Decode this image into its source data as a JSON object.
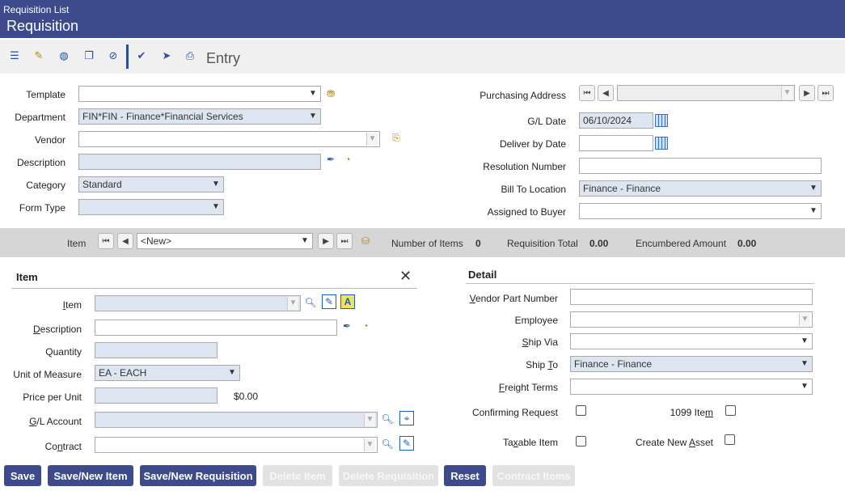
{
  "header": {
    "breadcrumb": "Requisition List",
    "title": "Requisition"
  },
  "toolbar": {
    "mode_label": "Entry",
    "icons": [
      "list-icon",
      "edit-icon",
      "globe-icon",
      "copy-icon",
      "void-icon",
      "approve-icon",
      "submit-icon",
      "print-icon"
    ]
  },
  "left_form": {
    "template": {
      "label": "Template",
      "value": ""
    },
    "department": {
      "label": "Department",
      "value": "FIN*FIN - Finance*Financial Services"
    },
    "vendor": {
      "label": "Vendor",
      "value": ""
    },
    "description": {
      "label": "Description",
      "value": ""
    },
    "category": {
      "label": "Category",
      "value": "Standard"
    },
    "form_type": {
      "label": "Form Type",
      "value": ""
    }
  },
  "right_form": {
    "purchasing_address": {
      "label": "Purchasing Address",
      "value": ""
    },
    "gl_date": {
      "label": "G/L Date",
      "value": "06/10/2024"
    },
    "deliver_by_date": {
      "label": "Deliver by Date",
      "value": ""
    },
    "resolution_number": {
      "label": "Resolution Number",
      "value": ""
    },
    "bill_to_location": {
      "label": "Bill To Location",
      "value": "Finance - Finance"
    },
    "assigned_to_buyer": {
      "label": "Assigned to Buyer",
      "value": ""
    }
  },
  "item_bar": {
    "item_label": "Item",
    "item_value": "<New>",
    "number_of_items_label": "Number of Items",
    "number_of_items": "0",
    "requisition_total_label": "Requisition Total",
    "requisition_total": "0.00",
    "encumbered_amount_label": "Encumbered Amount",
    "encumbered_amount": "0.00"
  },
  "item_section": {
    "title": "Item",
    "item": {
      "label": "Item",
      "value": ""
    },
    "description": {
      "label": "Description",
      "value": ""
    },
    "quantity": {
      "label": "Quantity",
      "value": ""
    },
    "unit_of_measure": {
      "label": "Unit of Measure",
      "value": "EA - EACH"
    },
    "price_per_unit": {
      "label": "Price per Unit",
      "value": "",
      "extended": "$0.00"
    },
    "gl_account": {
      "label": "G/L Account",
      "value": ""
    },
    "contract": {
      "label": "Contract",
      "value": ""
    }
  },
  "detail_section": {
    "title": "Detail",
    "vendor_part_number": {
      "label": "Vendor Part Number",
      "value": ""
    },
    "employee": {
      "label": "Employee",
      "value": ""
    },
    "ship_via": {
      "label": "Ship Via",
      "value": ""
    },
    "ship_to": {
      "label": "Ship To",
      "value": "Finance - Finance"
    },
    "freight_terms": {
      "label": "Freight Terms",
      "value": ""
    },
    "confirming_request": {
      "label": "Confirming Request",
      "checked": false
    },
    "item_1099": {
      "label": "1099 Item",
      "checked": false
    },
    "taxable_item": {
      "label": "Taxable Item",
      "checked": false
    },
    "create_new_asset": {
      "label": "Create New Asset",
      "checked": false
    }
  },
  "buttons": {
    "save": "Save",
    "save_new_item": "Save/New Item",
    "save_new_requisition": "Save/New Requisition",
    "delete_item": "Delete Item",
    "delete_requisition": "Delete Requisition",
    "reset": "Reset",
    "contract_items": "Contract Items"
  },
  "colors": {
    "header": "#3d4a8c",
    "button": "#3d4a8c",
    "field_readonly": "#dde6f0"
  }
}
